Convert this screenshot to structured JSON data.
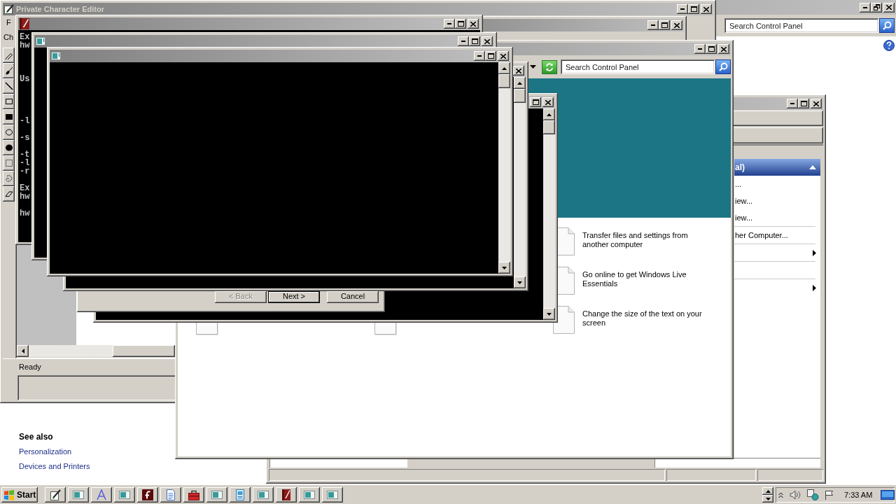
{
  "character_editor": {
    "title": "Private Character Editor",
    "menu": [
      "F"
    ],
    "toolbar_label": "Ch",
    "status": "Ready"
  },
  "control_panel_back": {
    "search": {
      "placeholder": "Search Control Panel"
    },
    "see_also": {
      "heading": "See also",
      "links": [
        "Personalization",
        "Devices and Printers"
      ]
    }
  },
  "console_window": {
    "lines": [
      "Ex",
      "hw",
      "Us",
      "-l",
      "-s",
      "-t",
      "-l",
      "-r",
      "Ex",
      "hw",
      "hw"
    ]
  },
  "control_panel": {
    "search": {
      "placeholder": "Search Control Panel"
    },
    "tasks": [
      "Transfer files and settings from another computer",
      "Go online to get Windows Live Essentials",
      "Change the size of the text on your screen"
    ]
  },
  "side_window": {
    "header": {
      "label": "al)",
      "expanded": true
    },
    "items": [
      {
        "kind": "link",
        "label": "..."
      },
      {
        "kind": "link",
        "label": "iew..."
      },
      {
        "kind": "link",
        "label": "iew..."
      },
      {
        "kind": "divider"
      },
      {
        "kind": "link",
        "label": "her Computer..."
      },
      {
        "kind": "divider"
      },
      {
        "kind": "submenu"
      },
      {
        "kind": "divider"
      },
      {
        "kind": "divider"
      },
      {
        "kind": "submenu"
      }
    ]
  },
  "wizard": {
    "buttons": [
      {
        "label": "< Back",
        "disabled": true,
        "default": false
      },
      {
        "label": "Next >",
        "disabled": false,
        "default": true
      },
      {
        "label": "Cancel",
        "disabled": false,
        "default": false
      }
    ]
  },
  "taskbar": {
    "start": "Start",
    "clock": "7:33 AM"
  }
}
